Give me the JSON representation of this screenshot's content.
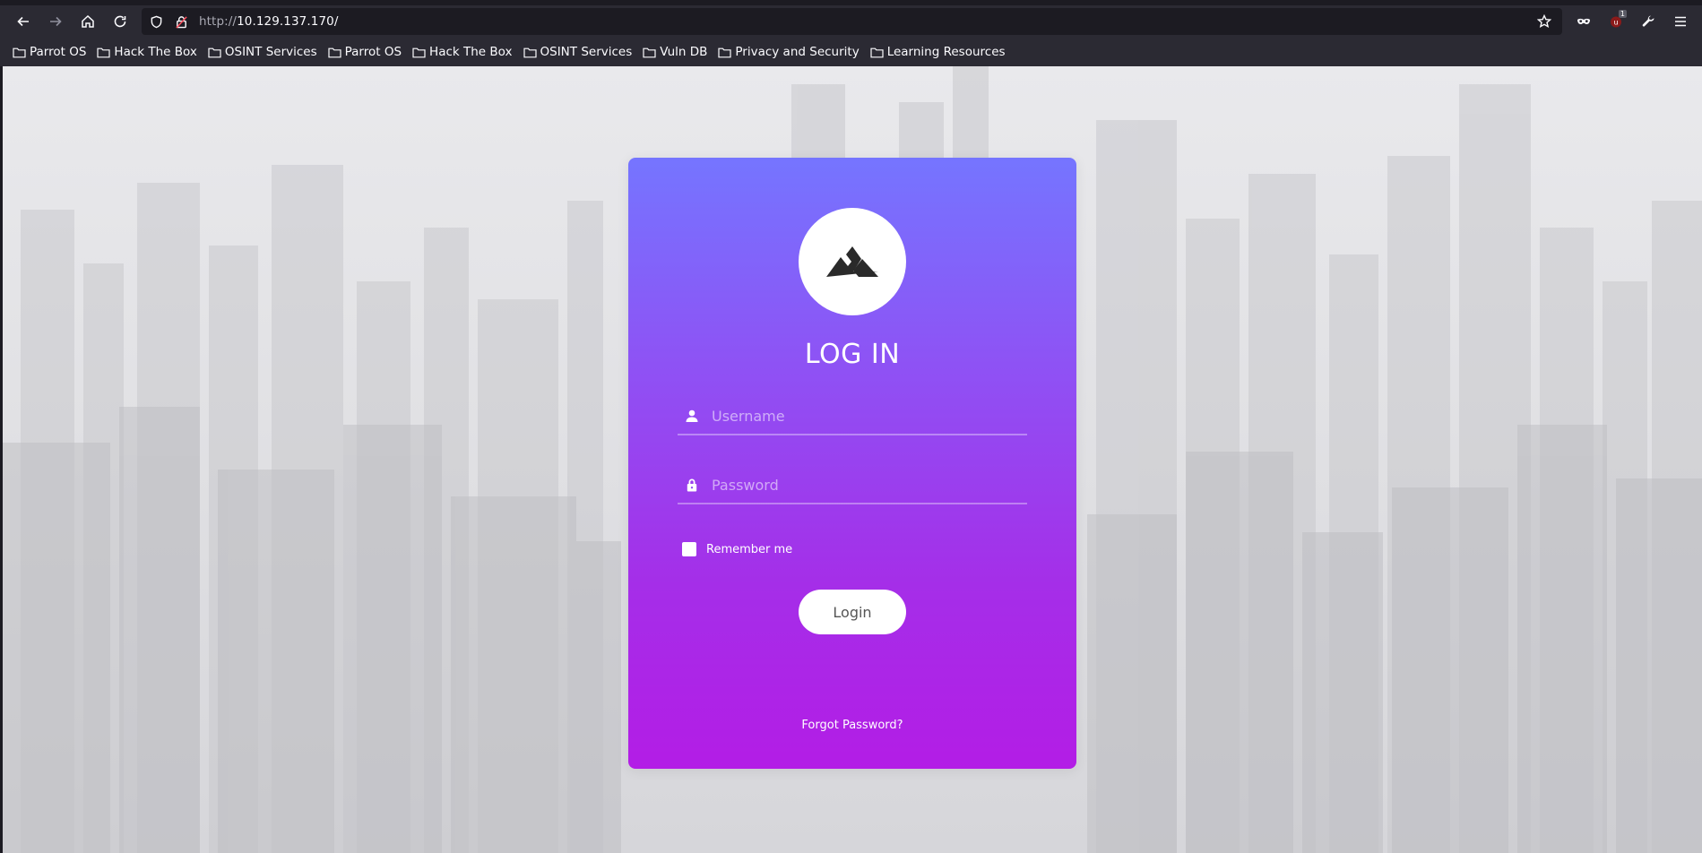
{
  "browser": {
    "url_scheme": "http://",
    "url_host": "10.129.137.170/",
    "extension_badge": "1",
    "nav_icons": [
      "back-arrow-icon",
      "forward-arrow-icon",
      "home-icon",
      "reload-icon"
    ],
    "toolbar_icons": [
      "star-icon",
      "private-mask-icon",
      "extension-icon",
      "wrench-icon",
      "hamburger-menu-icon"
    ]
  },
  "bookmarks": [
    {
      "label": "Parrot OS"
    },
    {
      "label": "Hack The Box"
    },
    {
      "label": "OSINT Services"
    },
    {
      "label": "Parrot OS"
    },
    {
      "label": "Hack The Box"
    },
    {
      "label": "OSINT Services"
    },
    {
      "label": "Vuln DB"
    },
    {
      "label": "Privacy and Security"
    },
    {
      "label": "Learning Resources"
    }
  ],
  "login": {
    "logo_icon": "mountain-icon",
    "title": "LOG IN",
    "username_placeholder": "Username",
    "username_value": "",
    "password_placeholder": "Password",
    "password_value": "",
    "remember_label": "Remember me",
    "remember_checked": false,
    "submit_label": "Login",
    "forgot_label": "Forgot Password?"
  },
  "colors": {
    "card_gradient_top": "#7575ff",
    "card_gradient_bottom": "#b31de6",
    "chrome_background": "#2b2a33"
  }
}
